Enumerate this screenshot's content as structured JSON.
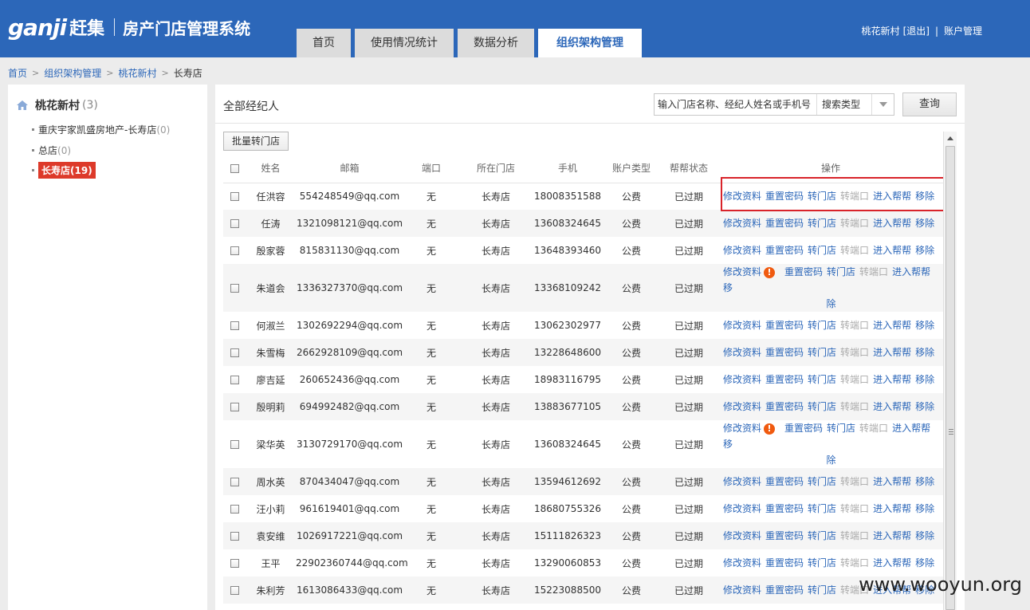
{
  "header": {
    "logo_word": "ganji",
    "logo_cn": "赶集",
    "system_title": "房产门店管理系统",
    "nav_tabs": [
      {
        "label": "首页",
        "active": false
      },
      {
        "label": "使用情况统计",
        "active": false
      },
      {
        "label": "数据分析",
        "active": false
      },
      {
        "label": "组织架构管理",
        "active": true
      }
    ],
    "user": {
      "name": "桃花新村",
      "logout": "[退出]",
      "separator": "|",
      "account": "账户管理"
    }
  },
  "breadcrumb": [
    "首页",
    "组织架构管理",
    "桃花新村",
    "长寿店"
  ],
  "sidebar": {
    "root": {
      "label": "桃花新村",
      "count": "(3)",
      "icon": "home-icon"
    },
    "items": [
      {
        "label": "重庆宇家凯盛房地产-长寿店",
        "count": "(0)",
        "active": false
      },
      {
        "label": "总店",
        "count": "(0)",
        "active": false
      },
      {
        "label": "长寿店",
        "count": "(19)",
        "active": true
      }
    ]
  },
  "main": {
    "title": "全部经纪人",
    "search": {
      "placeholder": "输入门店名称、经纪人姓名或手机号",
      "type_label": "搜索类型"
    },
    "query_button": "查询",
    "batch_button": "批量转门店",
    "columns": [
      "姓名",
      "邮箱",
      "端口",
      "所在门店",
      "手机",
      "账户类型",
      "帮帮状态",
      "操作"
    ],
    "operations": {
      "edit": "修改资料",
      "reset": "重置密码",
      "transfer_store": "转门店",
      "transfer_port": "转端口",
      "enter_help": "进入帮帮",
      "remove": "移除",
      "remove_part1": "移",
      "remove_part2": "除",
      "warn_icon": "!"
    },
    "rows": [
      {
        "name": "任洪容",
        "email": "554248549@qq.com",
        "port": "无",
        "store": "长寿店",
        "phone": "18008351588",
        "account_type": "公费",
        "status": "已过期",
        "warn": false
      },
      {
        "name": "任涛",
        "email": "1321098121@qq.com",
        "port": "无",
        "store": "长寿店",
        "phone": "13608324645",
        "account_type": "公费",
        "status": "已过期",
        "warn": false
      },
      {
        "name": "殷家蓉",
        "email": "815831130@qq.com",
        "port": "无",
        "store": "长寿店",
        "phone": "13648393460",
        "account_type": "公费",
        "status": "已过期",
        "warn": false
      },
      {
        "name": "朱道会",
        "email": "1336327370@qq.com",
        "port": "无",
        "store": "长寿店",
        "phone": "13368109242",
        "account_type": "公费",
        "status": "已过期",
        "warn": true
      },
      {
        "name": "何淑兰",
        "email": "1302692294@qq.com",
        "port": "无",
        "store": "长寿店",
        "phone": "13062302977",
        "account_type": "公费",
        "status": "已过期",
        "warn": false
      },
      {
        "name": "朱雪梅",
        "email": "2662928109@qq.com",
        "port": "无",
        "store": "长寿店",
        "phone": "13228648600",
        "account_type": "公费",
        "status": "已过期",
        "warn": false
      },
      {
        "name": "廖吉延",
        "email": "260652436@qq.com",
        "port": "无",
        "store": "长寿店",
        "phone": "18983116795",
        "account_type": "公费",
        "status": "已过期",
        "warn": false
      },
      {
        "name": "殷明莉",
        "email": "694992482@qq.com",
        "port": "无",
        "store": "长寿店",
        "phone": "13883677105",
        "account_type": "公费",
        "status": "已过期",
        "warn": false
      },
      {
        "name": "梁华英",
        "email": "3130729170@qq.com",
        "port": "无",
        "store": "长寿店",
        "phone": "13608324645",
        "account_type": "公费",
        "status": "已过期",
        "warn": true
      },
      {
        "name": "周水英",
        "email": "870434047@qq.com",
        "port": "无",
        "store": "长寿店",
        "phone": "13594612692",
        "account_type": "公费",
        "status": "已过期",
        "warn": false
      },
      {
        "name": "汪小莉",
        "email": "961619401@qq.com",
        "port": "无",
        "store": "长寿店",
        "phone": "18680755326",
        "account_type": "公费",
        "status": "已过期",
        "warn": false
      },
      {
        "name": "袁安维",
        "email": "1026917221@qq.com",
        "port": "无",
        "store": "长寿店",
        "phone": "15111826323",
        "account_type": "公费",
        "status": "已过期",
        "warn": false
      },
      {
        "name": "王平",
        "email": "22902360744@qq.com",
        "port": "无",
        "store": "长寿店",
        "phone": "13290060853",
        "account_type": "公费",
        "status": "已过期",
        "warn": false
      },
      {
        "name": "朱利芳",
        "email": "1613086433@qq.com",
        "port": "无",
        "store": "长寿店",
        "phone": "15223088500",
        "account_type": "公费",
        "status": "已过期",
        "warn": false
      }
    ]
  },
  "watermark": "www.wooyun.org",
  "colors": {
    "header_bg": "#2c67b9",
    "link": "#2c67b9",
    "active_store": "#dd3a2a",
    "highlight_border": "#d9232a",
    "warn": "#f05a0f"
  }
}
